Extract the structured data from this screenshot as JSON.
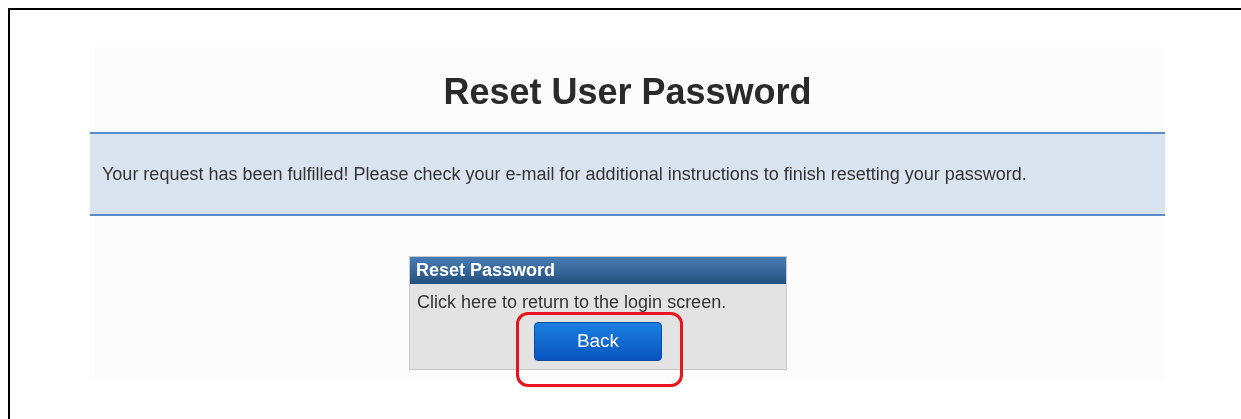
{
  "page": {
    "title": "Reset User Password"
  },
  "banner": {
    "message": "Your request has been fulfilled! Please check your e-mail for additional instructions to finish resetting your password."
  },
  "panel": {
    "title": "Reset Password",
    "text": "Click here to return to the login screen.",
    "button": "Back"
  }
}
